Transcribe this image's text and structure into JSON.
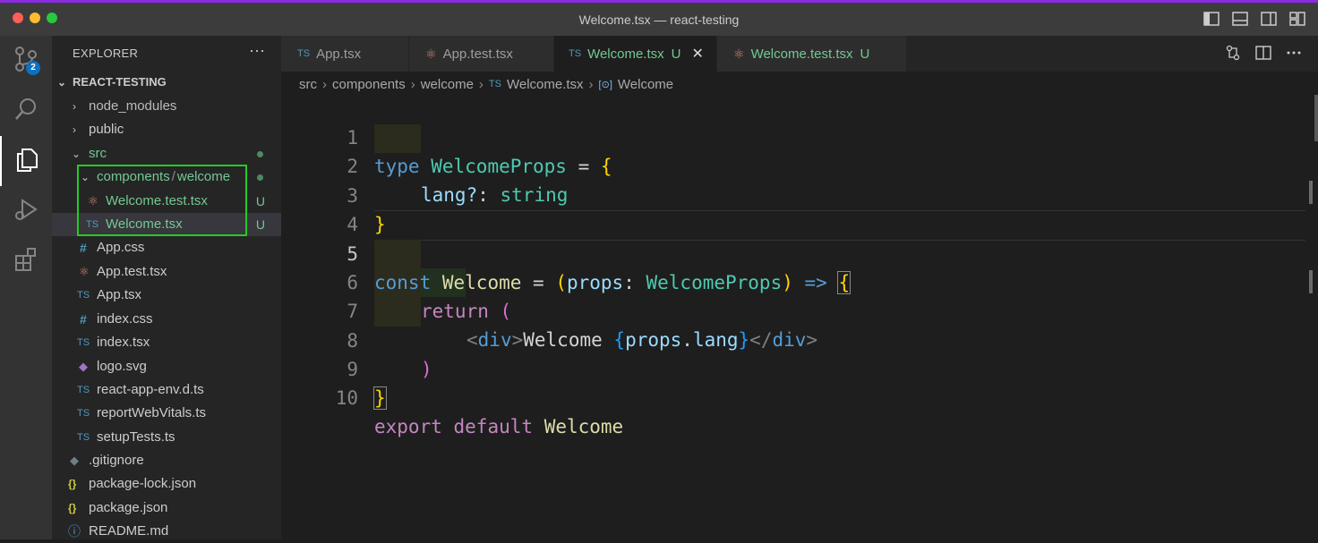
{
  "window": {
    "title": "Welcome.tsx — react-testing"
  },
  "activity_bar": {
    "source_control_badge": "2"
  },
  "explorer": {
    "header": "EXPLORER",
    "more": "···",
    "section": "REACT-TESTING",
    "items": [
      {
        "label": "node_modules",
        "icon": "chevron-right-icon"
      },
      {
        "label": "public",
        "icon": "chevron-right-icon"
      },
      {
        "label": "src",
        "icon": "chevron-down-icon"
      },
      {
        "label": "components",
        "sep": "/",
        "label2": "welcome"
      },
      {
        "label": "Welcome.test.tsx",
        "status": "U",
        "icon_text": "⚛"
      },
      {
        "label": "Welcome.tsx",
        "status": "U",
        "icon_text": "TS"
      },
      {
        "label": "App.css",
        "icon_text": "#"
      },
      {
        "label": "App.test.tsx",
        "icon_text": "⚛"
      },
      {
        "label": "App.tsx",
        "icon_text": "TS"
      },
      {
        "label": "index.css",
        "icon_text": "#"
      },
      {
        "label": "index.tsx",
        "icon_text": "TS"
      },
      {
        "label": "logo.svg",
        "icon_text": "◆"
      },
      {
        "label": "react-app-env.d.ts",
        "icon_text": "TS"
      },
      {
        "label": "reportWebVitals.ts",
        "icon_text": "TS"
      },
      {
        "label": "setupTests.ts",
        "icon_text": "TS"
      },
      {
        "label": ".gitignore",
        "icon_text": "◆"
      },
      {
        "label": "package-lock.json",
        "icon_text": "{}"
      },
      {
        "label": "package.json",
        "icon_text": "{}"
      },
      {
        "label": "README.md",
        "icon_text": "ⓘ"
      }
    ]
  },
  "tabs": [
    {
      "label": "App.tsx",
      "icon_text": "TS"
    },
    {
      "label": "App.test.tsx",
      "icon_text": "⚛"
    },
    {
      "label": "Welcome.tsx",
      "icon_text": "TS",
      "status": "U",
      "close": "✕"
    },
    {
      "label": "Welcome.test.tsx",
      "icon_text": "⚛",
      "status": "U"
    }
  ],
  "breadcrumb": {
    "items": [
      "src",
      "components",
      "welcome",
      "Welcome.tsx",
      "Welcome"
    ],
    "sep": "›",
    "file_icon": "TS",
    "symbol_icon": "[⊙]"
  },
  "editor": {
    "line_numbers": [
      "1",
      "2",
      "3",
      "4",
      "5",
      "6",
      "7",
      "8",
      "9",
      "10"
    ],
    "colors": {
      "keyword": "#569cd6",
      "control": "#c586c0",
      "type": "#4ec9b0",
      "variable": "#9cdcfe",
      "function": "#dcdcaa"
    },
    "tokens": {
      "l1": [
        "type",
        " ",
        "WelcomeProps",
        " = ",
        "{"
      ],
      "l2": [
        "lang?",
        ": ",
        "string"
      ],
      "l3": [
        "}"
      ],
      "l5": [
        "const",
        " ",
        "Welcome",
        " = ",
        "(",
        "props",
        ": ",
        "WelcomeProps",
        ") ",
        "=>",
        " ",
        "{"
      ],
      "l6": [
        "return",
        " ",
        "("
      ],
      "l7": [
        "<",
        "div",
        ">",
        "Welcome ",
        "{",
        "props",
        ".",
        "lang",
        "}",
        "</",
        "div",
        ">"
      ],
      "l8": [
        ")"
      ],
      "l9": [
        "}"
      ],
      "l10": [
        "export",
        " ",
        "default",
        " ",
        "Welcome"
      ]
    }
  }
}
